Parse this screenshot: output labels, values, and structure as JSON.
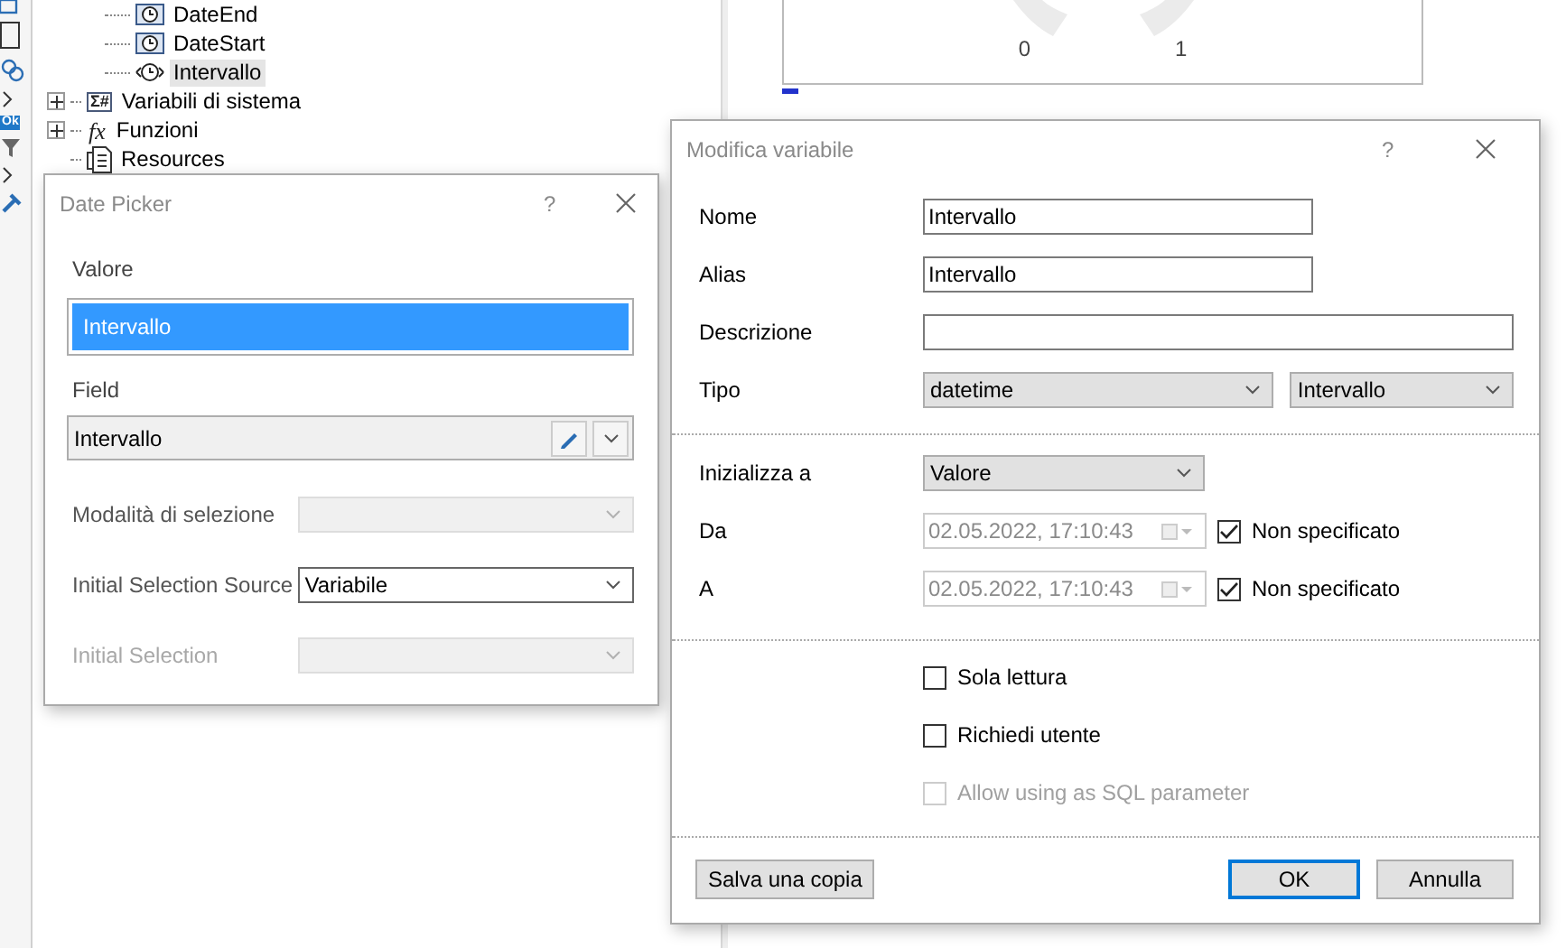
{
  "toolbar": {
    "badge": "Ok"
  },
  "tree": {
    "variables": [
      {
        "label": "DateEnd",
        "kind": "date",
        "selected": false
      },
      {
        "label": "DateStart",
        "kind": "date",
        "selected": false
      },
      {
        "label": "Intervallo",
        "kind": "range",
        "selected": true
      }
    ],
    "nodes": [
      {
        "label": "Variabili di sistema",
        "icon_text": "Σ#",
        "kind": "system",
        "expanded": false
      },
      {
        "label": "Funzioni",
        "icon_text": "fx",
        "kind": "function",
        "expanded": false
      },
      {
        "label": "Resources",
        "kind": "resource"
      }
    ]
  },
  "gauge": {
    "labels": [
      "0",
      "1"
    ]
  },
  "date_picker": {
    "title": "Date Picker",
    "help": "?",
    "value": {
      "label": "Valore",
      "text": "Intervallo",
      "selected": true
    },
    "field": {
      "label": "Field",
      "value": "Intervallo"
    },
    "rows": [
      {
        "label": "Modalità di selezione",
        "disabled": true,
        "dimmed": false
      },
      {
        "label": "Initial Selection Source",
        "value": "Variabile",
        "disabled": false,
        "dimmed": false
      },
      {
        "label": "Initial Selection",
        "disabled": true,
        "dimmed": true
      }
    ]
  },
  "edit_dialog": {
    "title": "Modifica variabile",
    "help": "?",
    "fields": [
      {
        "kind": "short_text",
        "label": "Nome",
        "value": "Intervallo"
      },
      {
        "kind": "short_text",
        "label": "Alias",
        "value": "Intervallo"
      },
      {
        "kind": "long_text",
        "label": "Descrizione"
      },
      {
        "kind": "select_pair",
        "label": "Tipo",
        "values": [
          "datetime",
          "Intervallo"
        ]
      }
    ],
    "init": {
      "label": "Inizializza a",
      "value": "Valore"
    },
    "ranges": [
      {
        "label": "Da",
        "value": "02.05.2022, 17:10:43",
        "disabled": true,
        "option": "Non specificato",
        "checked": true
      },
      {
        "label": "A",
        "value": "02.05.2022, 17:10:43",
        "disabled": true,
        "option": "Non specificato",
        "checked": true
      }
    ],
    "options": [
      {
        "label": "Sola lettura",
        "checked": false,
        "disabled": false
      },
      {
        "label": "Richiedi utente",
        "checked": false,
        "disabled": false
      },
      {
        "label": "Allow using as SQL parameter",
        "checked": false,
        "disabled": true
      }
    ],
    "buttons": [
      {
        "label": "Salva una copia",
        "kind": "secondary"
      },
      {
        "label": "OK",
        "kind": "default"
      },
      {
        "label": "Annulla",
        "kind": "normal"
      }
    ]
  }
}
